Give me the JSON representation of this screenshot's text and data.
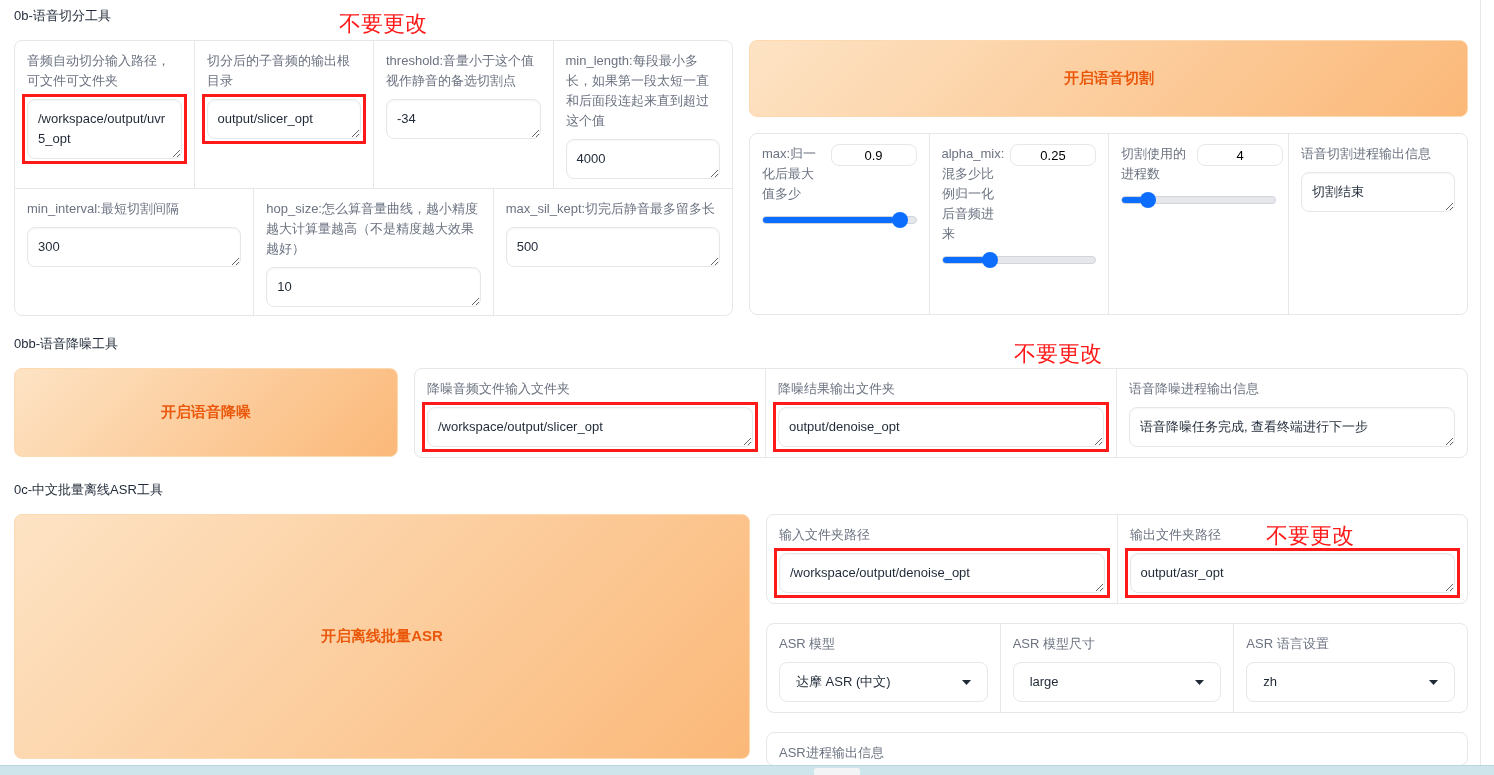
{
  "slicer": {
    "title": "0b-语音切分工具",
    "fields_row_1": [
      {
        "label": "音频自动切分输入路径，可文件可文件夹",
        "value": "/workspace/output/uvr5_opt",
        "highlighted": true
      },
      {
        "label": "切分后的子音频的输出根目录",
        "value": "output/slicer_opt",
        "highlighted": true,
        "note": "不要更改"
      },
      {
        "label": "threshold:音量小于这个值视作静音的备选切割点",
        "value": "-34",
        "highlighted": false
      },
      {
        "label": "min_length:每段最小多长，如果第一段太短一直和后面段连起来直到超过这个值",
        "value": "4000",
        "highlighted": false
      }
    ],
    "fields_row_2": [
      {
        "label": "min_interval:最短切割间隔",
        "value": "300",
        "highlighted": false
      },
      {
        "label": "hop_size:怎么算音量曲线，越小精度越大计算量越高（不是精度越大效果越好）",
        "value": "10",
        "highlighted": false
      },
      {
        "label": "max_sil_kept:切完后静音最多留多长",
        "value": "500",
        "highlighted": false
      }
    ],
    "button": "开启语音切割",
    "sliders": [
      {
        "label": "max:归一化后最大值多少",
        "value": "0.9",
        "level": 0.86
      },
      {
        "label": "alpha_mix:混多少比例归一化后音频进来",
        "value": "0.25",
        "level": 0.27
      },
      {
        "label": "切割使用的进程数",
        "value": "4",
        "level": 0.13
      }
    ],
    "output": {
      "label": "语音切割进程输出信息",
      "value": "切割结束"
    }
  },
  "denoise": {
    "title": "0bb-语音降噪工具",
    "button": "开启语音降噪",
    "fields": [
      {
        "label": "降噪音频文件输入文件夹",
        "value": "/workspace/output/slicer_opt",
        "highlighted": true
      },
      {
        "label": "降噪结果输出文件夹",
        "value": "output/denoise_opt",
        "highlighted": true,
        "note": "不要更改"
      },
      {
        "label": "语音降噪进程输出信息",
        "value": "语音降噪任务完成, 查看终端进行下一步",
        "highlighted": false
      }
    ]
  },
  "asr": {
    "title": "0c-中文批量离线ASR工具",
    "button": "开启离线批量ASR",
    "fields": [
      {
        "label": "输入文件夹路径",
        "value": "/workspace/output/denoise_opt",
        "highlighted": true
      },
      {
        "label": "输出文件夹路径",
        "value": "output/asr_opt",
        "highlighted": true,
        "note": "不要更改"
      }
    ],
    "dropdowns": [
      {
        "label": "ASR 模型",
        "value": "达摩 ASR (中文)"
      },
      {
        "label": "ASR 模型尺寸",
        "value": "large"
      },
      {
        "label": "ASR 语言设置",
        "value": "zh"
      }
    ],
    "output": {
      "label": "ASR进程输出信息"
    }
  }
}
